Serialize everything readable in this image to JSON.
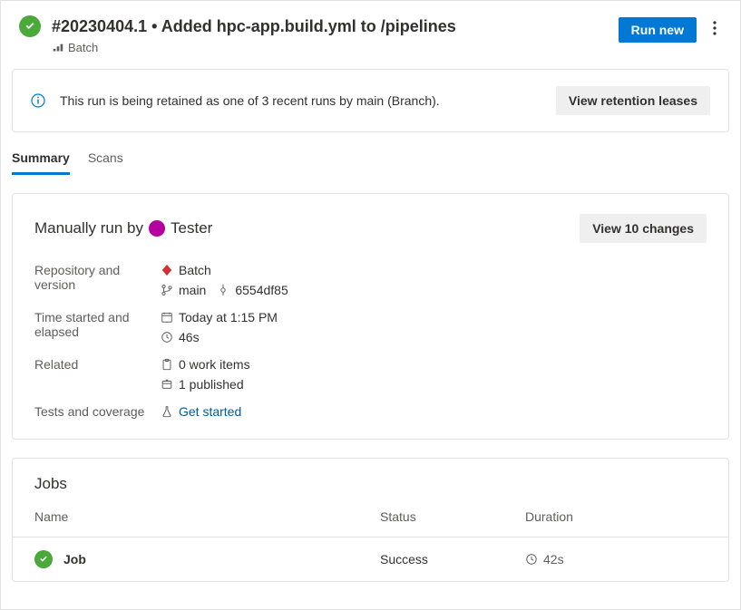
{
  "header": {
    "title": "#20230404.1 • Added hpc-app.build.yml to /pipelines",
    "pipeline_name": "Batch",
    "run_new_label": "Run new"
  },
  "banner": {
    "message": "This run is being retained as one of 3 recent runs by main (Branch).",
    "button_label": "View retention leases"
  },
  "tabs": {
    "summary": "Summary",
    "scans": "Scans"
  },
  "summary": {
    "run_by_prefix": "Manually run by",
    "run_by_user": "Tester",
    "changes_button": "View 10 changes",
    "labels": {
      "repo": "Repository and version",
      "time": "Time started and elapsed",
      "related": "Related",
      "tests": "Tests and coverage"
    },
    "repo_name": "Batch",
    "branch": "main",
    "commit": "6554df85",
    "started": "Today at 1:15 PM",
    "elapsed": "46s",
    "work_items": "0 work items",
    "published": "1 published",
    "tests_link": "Get started"
  },
  "jobs": {
    "title": "Jobs",
    "columns": {
      "name": "Name",
      "status": "Status",
      "duration": "Duration"
    },
    "rows": [
      {
        "name": "Job",
        "status": "Success",
        "duration": "42s"
      }
    ]
  }
}
